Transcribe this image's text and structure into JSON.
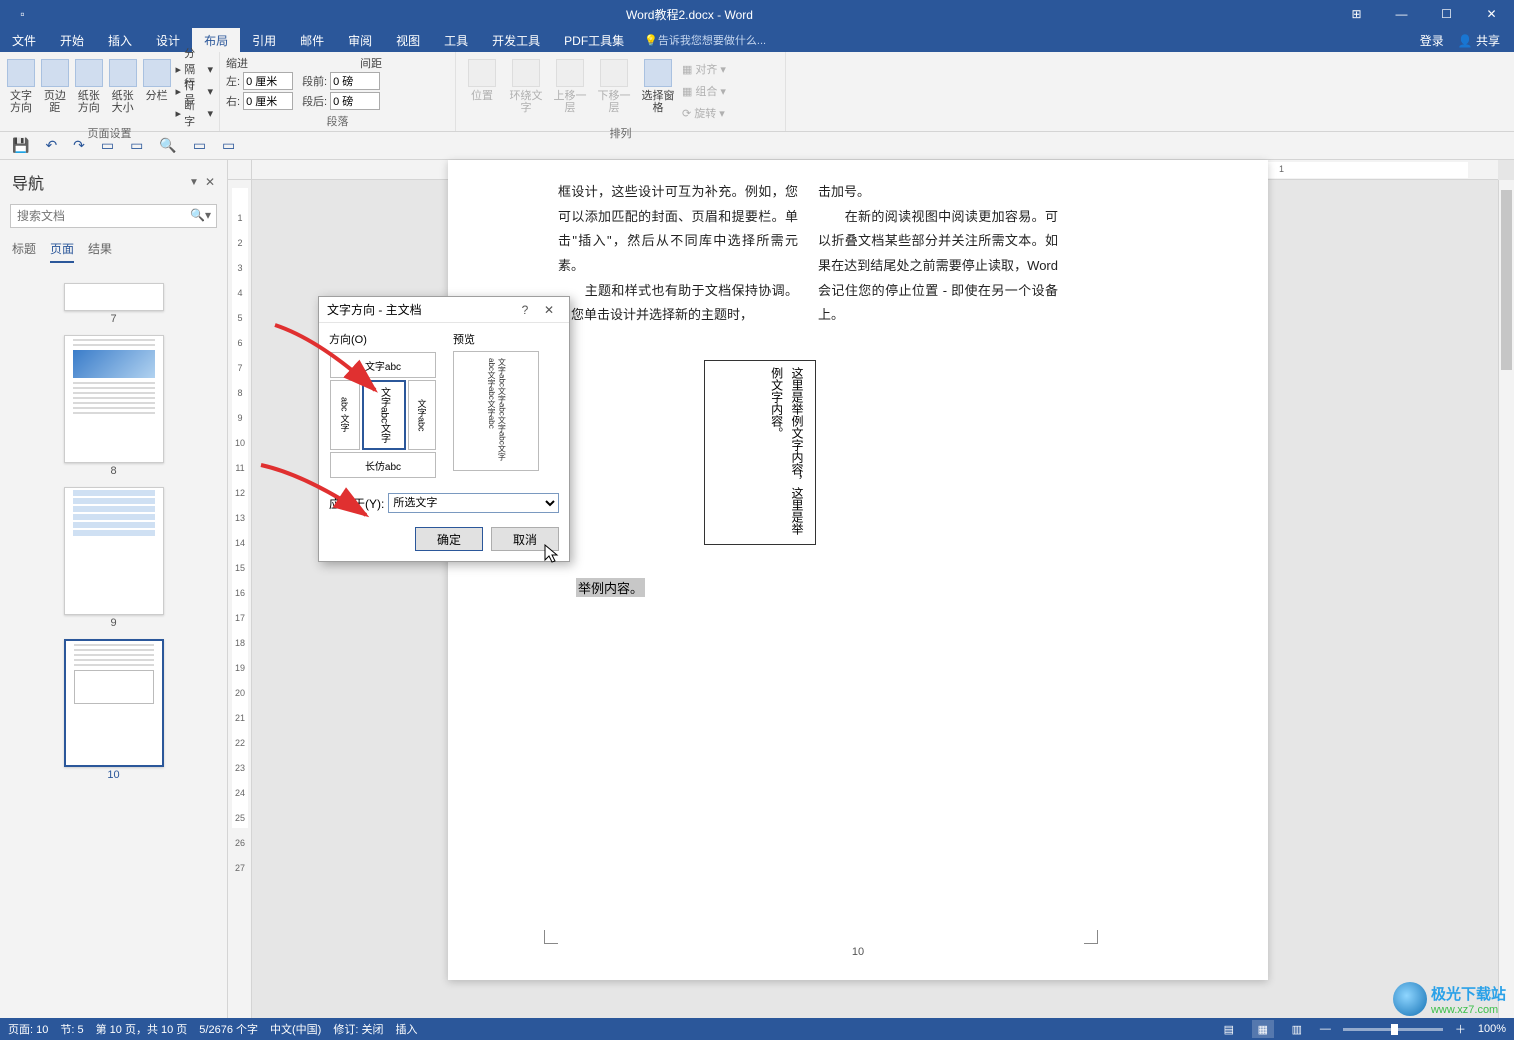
{
  "title": "Word教程2.docx - Word",
  "menu": {
    "file": "文件",
    "home": "开始",
    "insert": "插入",
    "design": "设计",
    "layout": "布局",
    "references": "引用",
    "mail": "邮件",
    "review": "审阅",
    "view": "视图",
    "tools": "工具",
    "dev": "开发工具",
    "pdf": "PDF工具集",
    "tellme": "告诉我您想要做什么...",
    "login": "登录",
    "share": "共享"
  },
  "ribbon": {
    "page_setup": "页面设置",
    "paragraph": "段落",
    "arrange": "排列",
    "text_dir": "文字方向",
    "margins": "页边距",
    "orient": "纸张方向",
    "size": "纸张大小",
    "columns": "分栏",
    "breaks": "分隔符",
    "line_no": "行号",
    "hyph": "断字",
    "indent": "缩进",
    "spacing": "间距",
    "left": "左:",
    "right": "右:",
    "before": "段前:",
    "after": "段后:",
    "indent_l": "0 厘米",
    "indent_r": "0 厘米",
    "sp_before": "0 磅",
    "sp_after": "0 磅",
    "position": "位置",
    "wrap": "环绕文字",
    "forward": "上移一层",
    "backward": "下移一层",
    "select_pane": "选择窗格",
    "align": "对齐",
    "group": "组合",
    "rotate": "旋转"
  },
  "nav": {
    "title": "导航",
    "search_ph": "搜索文档",
    "headings": "标题",
    "pages": "页面",
    "results": "结果",
    "p7": "7",
    "p8": "8",
    "p9": "9",
    "p10": "10"
  },
  "doc": {
    "col1": "框设计，这些设计可互为补充。例如，您可以添加匹配的封面、页眉和提要栏。单击\"插入\"，然后从不同库中选择所需元素。\n　　主题和样式也有助于文档保持协调。当您单击设计并选择新的主题时，",
    "col2": "击加号。\n　　在新的阅读视图中阅读更加容易。可以折叠文档某些部分并关注所需文本。如果在达到结尾处之前需要停止读取，Word 会记住您的停止位置 - 即使在另一个设备上。",
    "vbox": "这里是举例文字内容，这里是举例文字内容。",
    "sel": "举例内容。",
    "pgnum": "10"
  },
  "dialog": {
    "title": "文字方向 - 主文档",
    "orientation": "方向(O)",
    "preview": "预览",
    "o1": "文字abc",
    "o_mid_label": "文字abc文字",
    "o5": "长仿abc",
    "pv": "文字abc文字abc文字abc文字abc文字abc文字abc",
    "apply": "应用于(Y):",
    "apply_val": "所选文字",
    "ok": "确定",
    "cancel": "取消"
  },
  "status": {
    "page": "页面: 10",
    "sec": "节: 5",
    "pages": "第 10 页，共 10 页",
    "words": "5/2676 个字",
    "lang": "中文(中国)",
    "track": "修订: 关闭",
    "insert": "插入",
    "zoom": "100%"
  },
  "wm": {
    "t1": "极光下载站",
    "t2": "www.xz7.com"
  }
}
